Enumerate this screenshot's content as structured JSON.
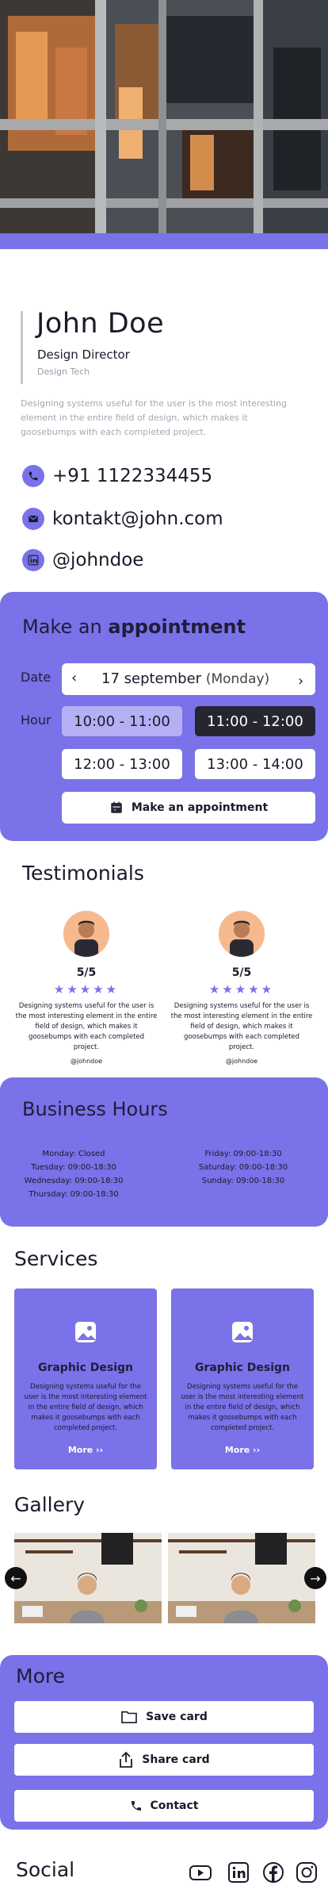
{
  "profile": {
    "name": "John Doe",
    "role": "Design Director",
    "company": "Design Tech",
    "bio": "Designing systems useful for the user is the most interesting element in the entire field of design, which makes it goosebumps with each completed project."
  },
  "contacts": [
    {
      "icon": "phone-icon",
      "text": "+91 1122334455"
    },
    {
      "icon": "mail-icon",
      "text": "kontakt@john.com"
    },
    {
      "icon": "linkedin-icon",
      "text": "@johndoe"
    }
  ],
  "appointment": {
    "title_pre": "Make an ",
    "title_bold": "appointment",
    "date_label": "Date",
    "hour_label": "Hour",
    "date_value": "17 september",
    "date_day": "(Monday)",
    "prev": "‹",
    "next": "›",
    "slots": [
      "10:00 - 11:00",
      "11:00 - 12:00",
      "12:00 - 13:00",
      "13:00 - 14:00"
    ],
    "button": "Make an appointment"
  },
  "testimonials": {
    "title": "Testimonials",
    "items": [
      {
        "rating": "5/5",
        "stars": "★★★★★",
        "text": "Designing systems useful for the user is the most interesting element in the entire field of design, which makes it goosebumps with each completed project.",
        "handle": "@johndoe"
      },
      {
        "rating": "5/5",
        "stars": "★★★★★",
        "text": "Designing systems useful for the user is the most interesting element in the entire field of design, which makes it goosebumps with each completed project.",
        "handle": "@johndoe"
      }
    ]
  },
  "hours": {
    "title": "Business Hours",
    "left": [
      "Monday: Closed",
      "Tuesday: 09:00-18:30",
      "Wednesday: 09:00-18:30",
      "Thursday: 09:00-18:30"
    ],
    "right": [
      "Friday: 09:00-18:30",
      "Saturday: 09:00-18:30",
      "Sunday: 09:00-18:30"
    ]
  },
  "services": {
    "title": "Services",
    "items": [
      {
        "title": "Graphic Design",
        "text": "Designing systems useful for the user is the most interesting element in the entire field of design, which makes it goosebumps with each completed project.",
        "more": "More ››"
      },
      {
        "title": "Graphic Design",
        "text": "Designing systems useful for the user is the most interesting element in the entire field of design, which makes it goosebumps with each completed project.",
        "more": "More ››"
      }
    ]
  },
  "gallery": {
    "title": "Gallery",
    "prev": "←",
    "next": "→"
  },
  "more": {
    "title": "More",
    "save": "Save card",
    "share": "Share card",
    "contact": "Contact"
  },
  "social": {
    "title": "Social",
    "icons": [
      "youtube-icon",
      "linkedin-icon",
      "facebook-icon",
      "instagram-icon"
    ]
  },
  "colors": {
    "accent": "#7a72e8",
    "dark": "#262631",
    "slot_light": "#b5b0f4"
  }
}
